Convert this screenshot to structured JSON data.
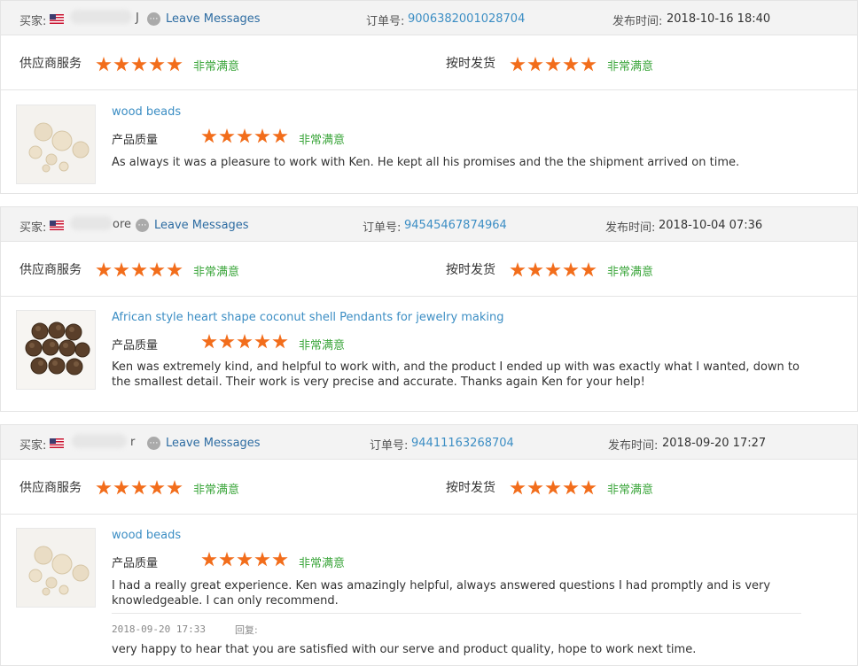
{
  "labels": {
    "buyer": "买家:",
    "order_no": "订单号:",
    "published": "发布时间:",
    "supplier_service": "供应商服务",
    "on_time_shipping": "按时发货",
    "product_quality": "产品质量",
    "very_satisfied": "非常满意",
    "leave_messages": "Leave Messages",
    "reply_label": "回复:"
  },
  "colors": {
    "star": "#f26d1b",
    "link": "#3c8ec4",
    "satisfied": "#3aa53a",
    "header_bg": "#f3f3f3"
  },
  "reviews": [
    {
      "buyer_name_stub": "J",
      "order_no": "9006382001028704",
      "published": "2018-10-16 18:40",
      "supplier_service_rating": 5,
      "on_time_shipping_rating": 5,
      "product_title": "wood beads",
      "product_quality_rating": 5,
      "thumbnail_icon": "wood-beads-image",
      "text": "As always it was a pleasure to work with Ken. He kept all his promises and the the shipment arrived on time."
    },
    {
      "buyer_name_stub": "ore",
      "order_no": "94545467874964",
      "published": "2018-10-04 07:36",
      "supplier_service_rating": 5,
      "on_time_shipping_rating": 5,
      "product_title": "African style heart shape coconut shell Pendants for jewelry making",
      "product_quality_rating": 5,
      "thumbnail_icon": "coconut-shell-pendants-image",
      "text": "Ken was extremely kind, and helpful to work with, and the product I ended up with was exactly what I wanted, down to the smallest detail. Their work is very precise and accurate. Thanks again Ken for your help!"
    },
    {
      "buyer_name_stub": "r",
      "order_no": "94411163268704",
      "published": "2018-09-20 17:27",
      "supplier_service_rating": 5,
      "on_time_shipping_rating": 5,
      "product_title": "wood beads",
      "product_quality_rating": 5,
      "thumbnail_icon": "wood-beads-image",
      "text": "I had a really great experience. Ken was amazingly helpful, always answered questions I had promptly and is very knowledgeable. I can only recommend.",
      "reply_date": "2018-09-20 17:33",
      "reply_text": "very happy to hear that you are satisfied with our serve and product quality, hope to work next time."
    }
  ]
}
